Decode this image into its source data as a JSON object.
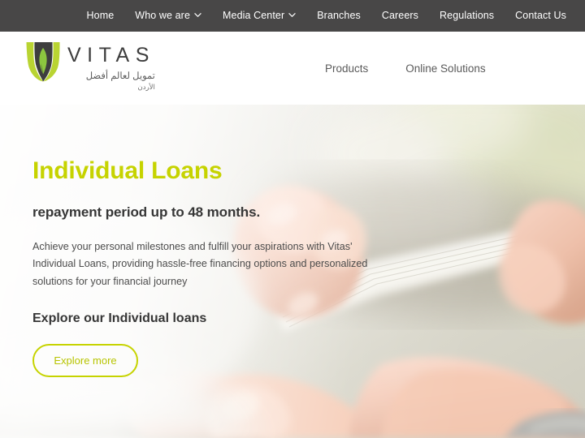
{
  "topnav": {
    "items": [
      {
        "label": "Home",
        "has_dropdown": false,
        "icon": null
      },
      {
        "label": "Who we are",
        "has_dropdown": true,
        "icon": "chevron-down-icon"
      },
      {
        "label": "Media Center",
        "has_dropdown": true,
        "icon": "chevron-down-icon"
      },
      {
        "label": "Branches",
        "has_dropdown": false,
        "icon": null
      },
      {
        "label": "Careers",
        "has_dropdown": false,
        "icon": null
      },
      {
        "label": "Regulations",
        "has_dropdown": false,
        "icon": null
      },
      {
        "label": "Contact Us",
        "has_dropdown": false,
        "icon": null
      }
    ],
    "background_color": "#484747",
    "text_color": "#ffffff"
  },
  "header": {
    "logo": {
      "icon": "vitas-shield-logo",
      "wordmark": "VITAS",
      "tagline_ar": "تمويل لعالم أفضل",
      "country_ar": "الأردن",
      "mark_green": "#b9d432",
      "mark_dark": "#3e3e3e",
      "mark_accent": "#8cc63f"
    },
    "nav": [
      {
        "label": "Products"
      },
      {
        "label": "Online Solutions"
      }
    ],
    "background_color": "#ffffff"
  },
  "hero": {
    "title": "Individual Loans",
    "subtitle": "repayment period up to 48 months.",
    "paragraph": "Achieve your personal milestones and fulfill your aspirations with Vitas' Individual Loans, providing hassle-free financing options and personalized solutions for your financial journey",
    "cta_heading": "Explore our Individual loans",
    "button_label": "Explore more",
    "accent_color": "#c6d300",
    "heading_color": "#363636",
    "background_image": "hands-counting-banknotes-handshake"
  }
}
